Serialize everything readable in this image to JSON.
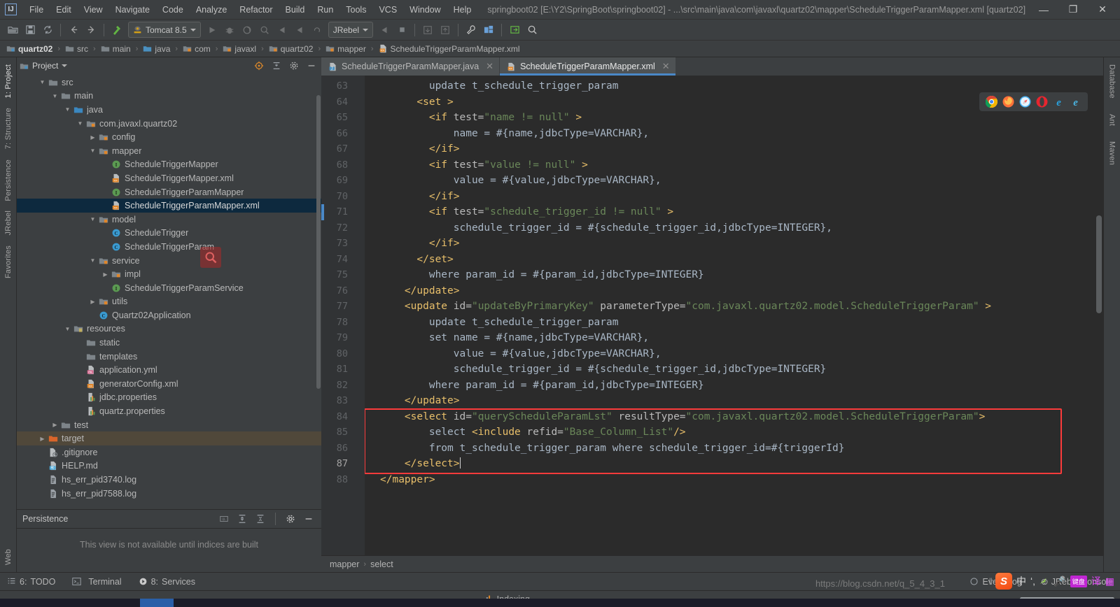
{
  "titlebar": {
    "logo": "IJ",
    "menus": [
      "File",
      "Edit",
      "View",
      "Navigate",
      "Code",
      "Analyze",
      "Refactor",
      "Build",
      "Run",
      "Tools",
      "VCS",
      "Window",
      "Help"
    ],
    "project_title": "springboot02 [E:\\Y2\\SpringBoot\\springboot02] - ...\\src\\main\\java\\com\\javaxl\\quartz02\\mapper\\ScheduleTriggerParamMapper.xml [quartz02]",
    "minimize": "—",
    "maximize": "❐",
    "close": "✕"
  },
  "toolbar": {
    "run_config": "Tomcat 8.5",
    "jrebel": "JRebel"
  },
  "breadcrumb": {
    "items": [
      {
        "label": "quartz02",
        "icon": "module-icon"
      },
      {
        "label": "src",
        "icon": "folder-icon"
      },
      {
        "label": "main",
        "icon": "folder-icon"
      },
      {
        "label": "java",
        "icon": "source-folder-icon"
      },
      {
        "label": "com",
        "icon": "package-icon"
      },
      {
        "label": "javaxl",
        "icon": "package-icon"
      },
      {
        "label": "quartz02",
        "icon": "package-icon"
      },
      {
        "label": "mapper",
        "icon": "package-icon"
      },
      {
        "label": "ScheduleTriggerParamMapper.xml",
        "icon": "xml-file-icon"
      }
    ],
    "separator": "›"
  },
  "left_rail": {
    "top": "1: Project",
    "mid": "7: Structure",
    "items": [
      "Persistence",
      "JRebel",
      "Favorites",
      "Web"
    ]
  },
  "right_rail": {
    "items": [
      "Database",
      "Ant",
      "Maven"
    ]
  },
  "project_panel": {
    "title": "Project",
    "tree": [
      {
        "depth": 1,
        "arrow": "▼",
        "icon": "folder-icon",
        "label": "src",
        "state": "normal"
      },
      {
        "depth": 2,
        "arrow": "▼",
        "icon": "folder-icon",
        "label": "main",
        "state": "normal"
      },
      {
        "depth": 3,
        "arrow": "▼",
        "icon": "source-folder-icon",
        "label": "java",
        "state": "normal"
      },
      {
        "depth": 4,
        "arrow": "▼",
        "icon": "package-icon",
        "label": "com.javaxl.quartz02",
        "state": "normal"
      },
      {
        "depth": 5,
        "arrow": "▶",
        "icon": "package-icon",
        "label": "config",
        "state": "normal"
      },
      {
        "depth": 5,
        "arrow": "▼",
        "icon": "package-icon",
        "label": "mapper",
        "state": "normal"
      },
      {
        "depth": 6,
        "arrow": "",
        "icon": "interface-icon",
        "label": "ScheduleTriggerMapper",
        "state": "normal"
      },
      {
        "depth": 6,
        "arrow": "",
        "icon": "xml-file-icon",
        "label": "ScheduleTriggerMapper.xml",
        "state": "normal"
      },
      {
        "depth": 6,
        "arrow": "",
        "icon": "interface-icon",
        "label": "ScheduleTriggerParamMapper",
        "state": "normal"
      },
      {
        "depth": 6,
        "arrow": "",
        "icon": "xml-file-icon",
        "label": "ScheduleTriggerParamMapper.xml",
        "state": "selected"
      },
      {
        "depth": 5,
        "arrow": "▼",
        "icon": "package-icon",
        "label": "model",
        "state": "normal"
      },
      {
        "depth": 6,
        "arrow": "",
        "icon": "class-icon",
        "label": "ScheduleTrigger",
        "state": "normal"
      },
      {
        "depth": 6,
        "arrow": "",
        "icon": "class-icon",
        "label": "ScheduleTriggerParam",
        "state": "normal"
      },
      {
        "depth": 5,
        "arrow": "▼",
        "icon": "package-icon",
        "label": "service",
        "state": "normal"
      },
      {
        "depth": 6,
        "arrow": "▶",
        "icon": "package-icon",
        "label": "impl",
        "state": "normal"
      },
      {
        "depth": 6,
        "arrow": "",
        "icon": "interface-icon",
        "label": "ScheduleTriggerParamService",
        "state": "normal"
      },
      {
        "depth": 5,
        "arrow": "▶",
        "icon": "package-icon",
        "label": "utils",
        "state": "normal"
      },
      {
        "depth": 5,
        "arrow": "",
        "icon": "class-icon",
        "label": "Quartz02Application",
        "state": "normal"
      },
      {
        "depth": 3,
        "arrow": "▼",
        "icon": "resource-folder-icon",
        "label": "resources",
        "state": "normal"
      },
      {
        "depth": 4,
        "arrow": "",
        "icon": "folder-icon",
        "label": "static",
        "state": "normal"
      },
      {
        "depth": 4,
        "arrow": "",
        "icon": "folder-icon",
        "label": "templates",
        "state": "normal"
      },
      {
        "depth": 4,
        "arrow": "",
        "icon": "yml-file-icon",
        "label": "application.yml",
        "state": "normal"
      },
      {
        "depth": 4,
        "arrow": "",
        "icon": "xml-file-icon",
        "label": "generatorConfig.xml",
        "state": "normal"
      },
      {
        "depth": 4,
        "arrow": "",
        "icon": "properties-file-icon",
        "label": "jdbc.properties",
        "state": "normal"
      },
      {
        "depth": 4,
        "arrow": "",
        "icon": "properties-file-icon",
        "label": "quartz.properties",
        "state": "normal"
      },
      {
        "depth": 2,
        "arrow": "▶",
        "icon": "folder-icon",
        "label": "test",
        "state": "normal"
      },
      {
        "depth": 1,
        "arrow": "▶",
        "icon": "target-folder-icon",
        "label": "target",
        "state": "target-sel"
      },
      {
        "depth": 1,
        "arrow": "",
        "icon": "gitignore-file-icon",
        "label": ".gitignore",
        "state": "normal"
      },
      {
        "depth": 1,
        "arrow": "",
        "icon": "md-file-icon",
        "label": "HELP.md",
        "state": "normal"
      },
      {
        "depth": 1,
        "arrow": "",
        "icon": "log-file-icon",
        "label": "hs_err_pid3740.log",
        "state": "normal"
      },
      {
        "depth": 1,
        "arrow": "",
        "icon": "log-file-icon",
        "label": "hs_err_pid7588.log",
        "state": "normal"
      }
    ]
  },
  "persistence_panel": {
    "title": "Persistence",
    "message": "This view is not available until indices are built"
  },
  "editor": {
    "tabs": [
      {
        "label": "ScheduleTriggerParamMapper.java",
        "icon": "java-file-icon",
        "active": false
      },
      {
        "label": "ScheduleTriggerParamMapper.xml",
        "icon": "xml-file-icon",
        "active": true
      }
    ],
    "first_line_number": 63,
    "lines": [
      {
        "n": 63,
        "fold": "",
        "indent": 4,
        "tokens": [
          {
            "t": "txt",
            "v": "update t_schedule_trigger_param"
          }
        ]
      },
      {
        "n": 64,
        "fold": "open",
        "indent": 3,
        "tokens": [
          {
            "t": "tg",
            "v": "<set >"
          }
        ]
      },
      {
        "n": 65,
        "fold": "open",
        "indent": 4,
        "tokens": [
          {
            "t": "tg",
            "v": "<if "
          },
          {
            "t": "at",
            "v": "test="
          },
          {
            "t": "st",
            "v": "\"name != null\""
          },
          {
            "t": "tg",
            "v": " >"
          }
        ]
      },
      {
        "n": 66,
        "fold": "",
        "indent": 6,
        "tokens": [
          {
            "t": "txt",
            "v": "name = #{name,jdbcType=VARCHAR},"
          }
        ]
      },
      {
        "n": 67,
        "fold": "close",
        "indent": 4,
        "tokens": [
          {
            "t": "tg",
            "v": "</if>"
          }
        ]
      },
      {
        "n": 68,
        "fold": "open",
        "indent": 4,
        "tokens": [
          {
            "t": "tg",
            "v": "<if "
          },
          {
            "t": "at",
            "v": "test="
          },
          {
            "t": "st",
            "v": "\"value != null\""
          },
          {
            "t": "tg",
            "v": " >"
          }
        ]
      },
      {
        "n": 69,
        "fold": "",
        "indent": 6,
        "tokens": [
          {
            "t": "txt",
            "v": "value = #{value,jdbcType=VARCHAR},"
          }
        ]
      },
      {
        "n": 70,
        "fold": "close",
        "indent": 4,
        "tokens": [
          {
            "t": "tg",
            "v": "</if>"
          }
        ]
      },
      {
        "n": 71,
        "fold": "open",
        "indent": 4,
        "tokens": [
          {
            "t": "tg",
            "v": "<if "
          },
          {
            "t": "at",
            "v": "test="
          },
          {
            "t": "st",
            "v": "\"schedule_trigger_id != null\""
          },
          {
            "t": "tg",
            "v": " >"
          }
        ]
      },
      {
        "n": 72,
        "fold": "",
        "indent": 6,
        "tokens": [
          {
            "t": "txt",
            "v": "schedule_trigger_id = #{schedule_trigger_id,jdbcType=INTEGER},"
          }
        ]
      },
      {
        "n": 73,
        "fold": "close",
        "indent": 4,
        "tokens": [
          {
            "t": "tg",
            "v": "</if>"
          }
        ]
      },
      {
        "n": 74,
        "fold": "close",
        "indent": 3,
        "tokens": [
          {
            "t": "tg",
            "v": "</set>"
          }
        ]
      },
      {
        "n": 75,
        "fold": "",
        "indent": 4,
        "tokens": [
          {
            "t": "txt",
            "v": "where param_id = #{param_id,jdbcType=INTEGER}"
          }
        ]
      },
      {
        "n": 76,
        "fold": "close",
        "indent": 2,
        "tokens": [
          {
            "t": "tg",
            "v": "</update>"
          }
        ]
      },
      {
        "n": 77,
        "fold": "open",
        "indent": 2,
        "tokens": [
          {
            "t": "tg",
            "v": "<update "
          },
          {
            "t": "at",
            "v": "id="
          },
          {
            "t": "st",
            "v": "\"updateByPrimaryKey\""
          },
          {
            "t": "at",
            "v": " parameterType="
          },
          {
            "t": "st",
            "v": "\"com.javaxl.quartz02.model.ScheduleTriggerParam\""
          },
          {
            "t": "tg",
            "v": " >"
          }
        ]
      },
      {
        "n": 78,
        "fold": "",
        "indent": 4,
        "tokens": [
          {
            "t": "txt",
            "v": "update t_schedule_trigger_param"
          }
        ]
      },
      {
        "n": 79,
        "fold": "",
        "indent": 4,
        "tokens": [
          {
            "t": "txt",
            "v": "set name = #{name,jdbcType=VARCHAR},"
          }
        ]
      },
      {
        "n": 80,
        "fold": "",
        "indent": 6,
        "tokens": [
          {
            "t": "txt",
            "v": "value = #{value,jdbcType=VARCHAR},"
          }
        ]
      },
      {
        "n": 81,
        "fold": "",
        "indent": 6,
        "tokens": [
          {
            "t": "txt",
            "v": "schedule_trigger_id = #{schedule_trigger_id,jdbcType=INTEGER}"
          }
        ]
      },
      {
        "n": 82,
        "fold": "",
        "indent": 4,
        "tokens": [
          {
            "t": "txt",
            "v": "where param_id = #{param_id,jdbcType=INTEGER}"
          }
        ]
      },
      {
        "n": 83,
        "fold": "close",
        "indent": 2,
        "tokens": [
          {
            "t": "tg",
            "v": "</update>"
          }
        ]
      },
      {
        "n": 84,
        "fold": "open",
        "indent": 2,
        "tokens": [
          {
            "t": "tg",
            "v": "<select "
          },
          {
            "t": "at",
            "v": "id="
          },
          {
            "t": "st",
            "v": "\"queryScheduleParamLst\""
          },
          {
            "t": "at",
            "v": " resultType="
          },
          {
            "t": "st",
            "v": "\"com.javaxl.quartz02.model.ScheduleTriggerParam\""
          },
          {
            "t": "tg",
            "v": ">"
          }
        ]
      },
      {
        "n": 85,
        "fold": "",
        "indent": 4,
        "tokens": [
          {
            "t": "txt",
            "v": "select "
          },
          {
            "t": "tg",
            "v": "<include "
          },
          {
            "t": "at",
            "v": "refid="
          },
          {
            "t": "st",
            "v": "\"Base_Column_List\""
          },
          {
            "t": "tg",
            "v": "/>"
          }
        ]
      },
      {
        "n": 86,
        "fold": "",
        "indent": 4,
        "tokens": [
          {
            "t": "txt",
            "v": "from t_schedule_trigger_param where schedule_trigger_id=#{triggerId}"
          }
        ]
      },
      {
        "n": 87,
        "fold": "close",
        "indent": 2,
        "tokens": [
          {
            "t": "tg",
            "v": "</select>"
          },
          {
            "t": "caret",
            "v": ""
          }
        ]
      },
      {
        "n": 88,
        "fold": "",
        "indent": 0,
        "tokens": [
          {
            "t": "tg",
            "v": "</mapper>"
          }
        ]
      }
    ],
    "highlight_box": {
      "from_line": 84,
      "to_line": 87,
      "color": "#fb3b3b"
    },
    "current_line": 87,
    "browsers": [
      "chrome-icon",
      "firefox-icon",
      "safari-icon",
      "opera-icon",
      "ie-icon",
      "edge-icon"
    ],
    "breadcrumb_status": [
      "mapper",
      "select"
    ],
    "breadcrumb_status_sep": "›"
  },
  "bottom_tabs": [
    {
      "num": "6:",
      "label": "TODO",
      "icon": "todo-icon"
    },
    {
      "num": "",
      "label": "Terminal",
      "icon": "terminal-icon"
    },
    {
      "num": "8:",
      "label": "Services",
      "icon": "services-icon"
    }
  ],
  "bottom_right_tabs": [
    {
      "label": "Event Log",
      "icon": "event-log-icon"
    },
    {
      "label": "JRebel Console",
      "icon": "jrebel-icon"
    }
  ],
  "statusbar": {
    "indexing_text": "Indexing...",
    "progress_percent": 100
  },
  "ime_overlay": {
    "logo": "S",
    "mode": "中",
    "keyboard_badge": "键盘",
    "watermark": "https://blog.csdn.net/q_5_4_3_1"
  },
  "colors": {
    "accent_blue": "#4a88c7",
    "panel_bg": "#3c3f41",
    "editor_bg": "#2b2b2b",
    "gutter_bg": "#313335",
    "tag": "#e8bf6a",
    "string": "#6a8759",
    "text": "#a9b7c6",
    "selection": "#0d293e",
    "highlight_border": "#fb3b3b"
  }
}
